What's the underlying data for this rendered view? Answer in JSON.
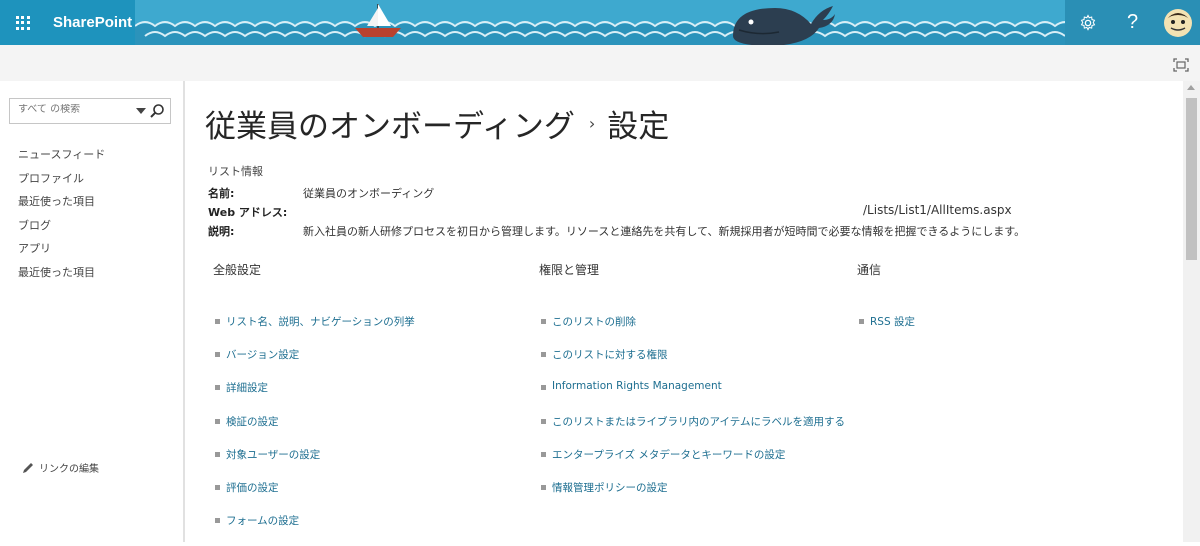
{
  "suite": {
    "brand": "SharePoint",
    "settings_icon": "gear-icon",
    "help_label": "?"
  },
  "search": {
    "placeholder": "すべて の検索"
  },
  "nav": {
    "items": [
      "ニュースフィード",
      "プロファイル",
      "最近使った項目",
      "ブログ",
      "アプリ",
      "最近使った項目"
    ],
    "edit_links": "リンクの編集"
  },
  "page": {
    "title": "従業員のオンボーディング",
    "separator": "›",
    "subtitle": "設定"
  },
  "list_info": {
    "heading": "リスト情報",
    "name_label": "名前:",
    "name_value": "従業員のオンボーディング",
    "web_label": "Web アドレス:",
    "web_value": "/Lists/List1/AllItems.aspx",
    "desc_label": "説明:",
    "desc_value": "新入社員の新人研修プロセスを初日から管理します。リソースと連絡先を共有して、新規採用者が短時間で必要な情報を把握できるようにします。"
  },
  "sections": [
    {
      "heading": "全般設定",
      "links": [
        "リスト名、説明、ナビゲーションの列挙",
        "バージョン設定",
        "詳細設定",
        "検証の設定",
        "対象ユーザーの設定",
        "評価の設定",
        "フォームの設定"
      ]
    },
    {
      "heading": "権限と管理",
      "links": [
        "このリストの削除",
        "このリストに対する権限",
        "Information Rights Management",
        "このリストまたはライブラリ内のアイテムにラベルを適用する",
        "エンタープライズ メタデータとキーワードの設定",
        "情報管理ポリシーの設定"
      ]
    },
    {
      "heading": "通信",
      "links": [
        "RSS 設定"
      ]
    }
  ],
  "colors": {
    "suitebar": "#2da1c7",
    "link": "#1d6e90"
  }
}
